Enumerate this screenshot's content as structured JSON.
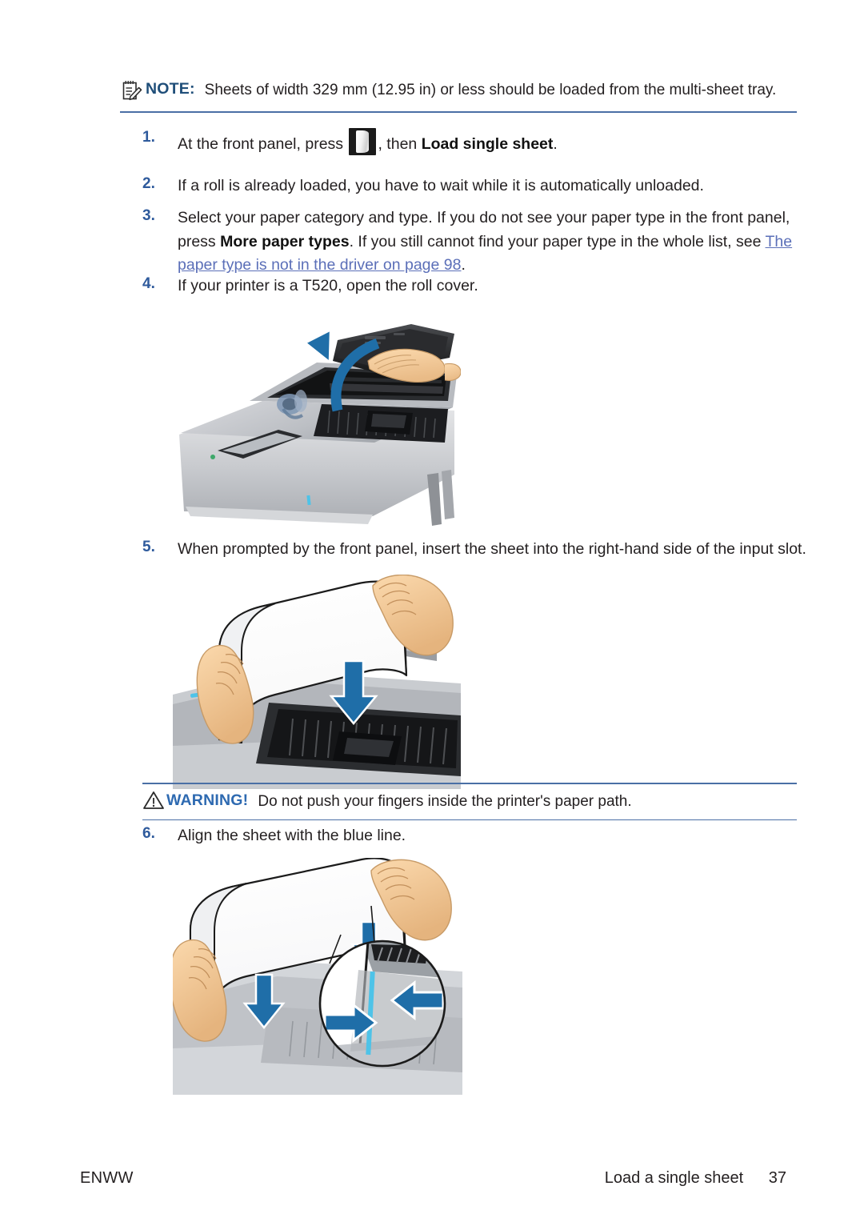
{
  "document": {
    "note": {
      "icon": "note-pad-pencil-icon",
      "label": "NOTE:",
      "text": "Sheets of width 329 mm (12.95 in) or less should be loaded from the multi-sheet tray."
    },
    "warning": {
      "icon": "warning-triangle-icon",
      "label": "WARNING!",
      "text": "Do not push your fingers inside the printer's paper path."
    },
    "steps": [
      {
        "number": "1.",
        "text_before": "At the front panel, press",
        "inline_icon": "front-panel-paper-button-icon",
        "text_middle": ", then ",
        "bold": "Load single sheet",
        "text_after": "."
      },
      {
        "number": "2.",
        "text": "If a roll is already loaded, you have to wait while it is automatically unloaded."
      },
      {
        "number": "3.",
        "part1": "Select your paper category and type. If you do not see your paper type in the front panel, press ",
        "bold": "More paper types",
        "part2": ". If you still cannot find your paper type in the whole list, see ",
        "link": "The paper type is not in the driver on page 98",
        "part3": "."
      },
      {
        "number": "4.",
        "text": "If your printer is a T520, open the roll cover."
      },
      {
        "number": "5.",
        "text": "When prompted by the front panel, insert the sheet into the right-hand side of the input slot."
      },
      {
        "number": "6.",
        "text": "Align the sheet with the blue line."
      }
    ],
    "figures": [
      {
        "name": "figure-open-roll-cover",
        "alt": "Large-format printer with the roll cover lifted open, a hand resting on the cover, and a curved blue arrow indicating the upward opening motion."
      },
      {
        "name": "figure-insert-sheet",
        "alt": "Two hands holding a curved white sheet above the printer input slot with a blue downward arrow indicating insertion."
      },
      {
        "name": "figure-align-sheet-blue-line",
        "alt": "Two hands aligning a white sheet, with a circular magnified callout showing two blue arrows converging on the light blue alignment line."
      }
    ],
    "footer": {
      "left": "ENWW",
      "section": "Load a single sheet",
      "page": "37"
    },
    "colors": {
      "note_label": "#1f4e79",
      "warning_label": "#2e6ab1",
      "step_number": "#2e5a9c",
      "rule": "#4a6fa5",
      "link": "#5b6fb8",
      "arrow_blue": "#1f6ea8",
      "align_line": "#4ec3e8",
      "text": "#231f20"
    }
  }
}
